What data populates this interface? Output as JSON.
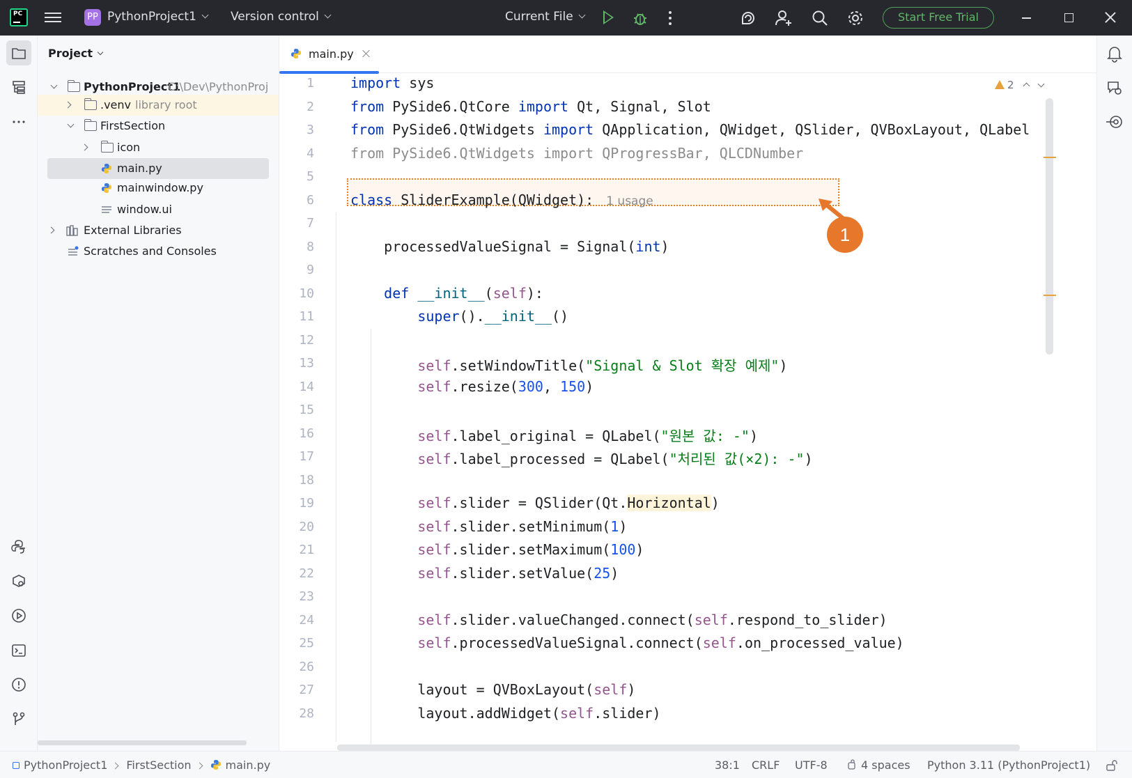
{
  "titlebar": {
    "logo_text": "PC",
    "project_badge": "PP",
    "project_name": "PythonProject1",
    "version_control": "Version control",
    "run_config": "Current File",
    "start_trial": "Start Free Trial",
    "icons": [
      "menu-icon",
      "run-icon",
      "debug-icon",
      "more-icon",
      "ai-assistant-icon",
      "add-user-icon",
      "search-icon",
      "settings-icon",
      "minimize-icon",
      "maximize-icon",
      "close-icon"
    ]
  },
  "project_panel": {
    "title": "Project",
    "tree": [
      {
        "label": "PythonProject1",
        "path": "C:\\Dev\\PythonProj"
      },
      {
        "label": ".venv",
        "note": "library root"
      },
      {
        "label": "FirstSection"
      },
      {
        "label": "icon"
      },
      {
        "label": "main.py"
      },
      {
        "label": "mainwindow.py"
      },
      {
        "label": "window.ui"
      },
      {
        "label": "External Libraries"
      },
      {
        "label": "Scratches and Consoles"
      }
    ]
  },
  "editor": {
    "tab_label": "main.py",
    "warnings_count": "2",
    "usage_hint": "1 usage",
    "callout_number": "1",
    "line_numbers": [
      "1",
      "2",
      "3",
      "4",
      "5",
      "6",
      "7",
      "8",
      "9",
      "10",
      "11",
      "12",
      "13",
      "14",
      "15",
      "16",
      "17",
      "18",
      "19",
      "20",
      "21",
      "22",
      "23",
      "24",
      "25",
      "26",
      "27",
      "28"
    ],
    "unused_import_line": "from PySide6.QtWidgets import QProgressBar, QLCDNumber"
  },
  "statusbar": {
    "breadcrumb": [
      "PythonProject1",
      "FirstSection",
      "main.py"
    ],
    "position": "38:1",
    "line_separator": "CRLF",
    "encoding": "UTF-8",
    "indent": "4 spaces",
    "interpreter": "Python 3.11 (PythonProject1)"
  },
  "colors": {
    "keyword": "#0033b3",
    "string": "#067d17",
    "number": "#1750eb",
    "self": "#94558d",
    "accent": "#3574f0",
    "callout": "#e7772b",
    "trial_green": "#5fb865"
  }
}
